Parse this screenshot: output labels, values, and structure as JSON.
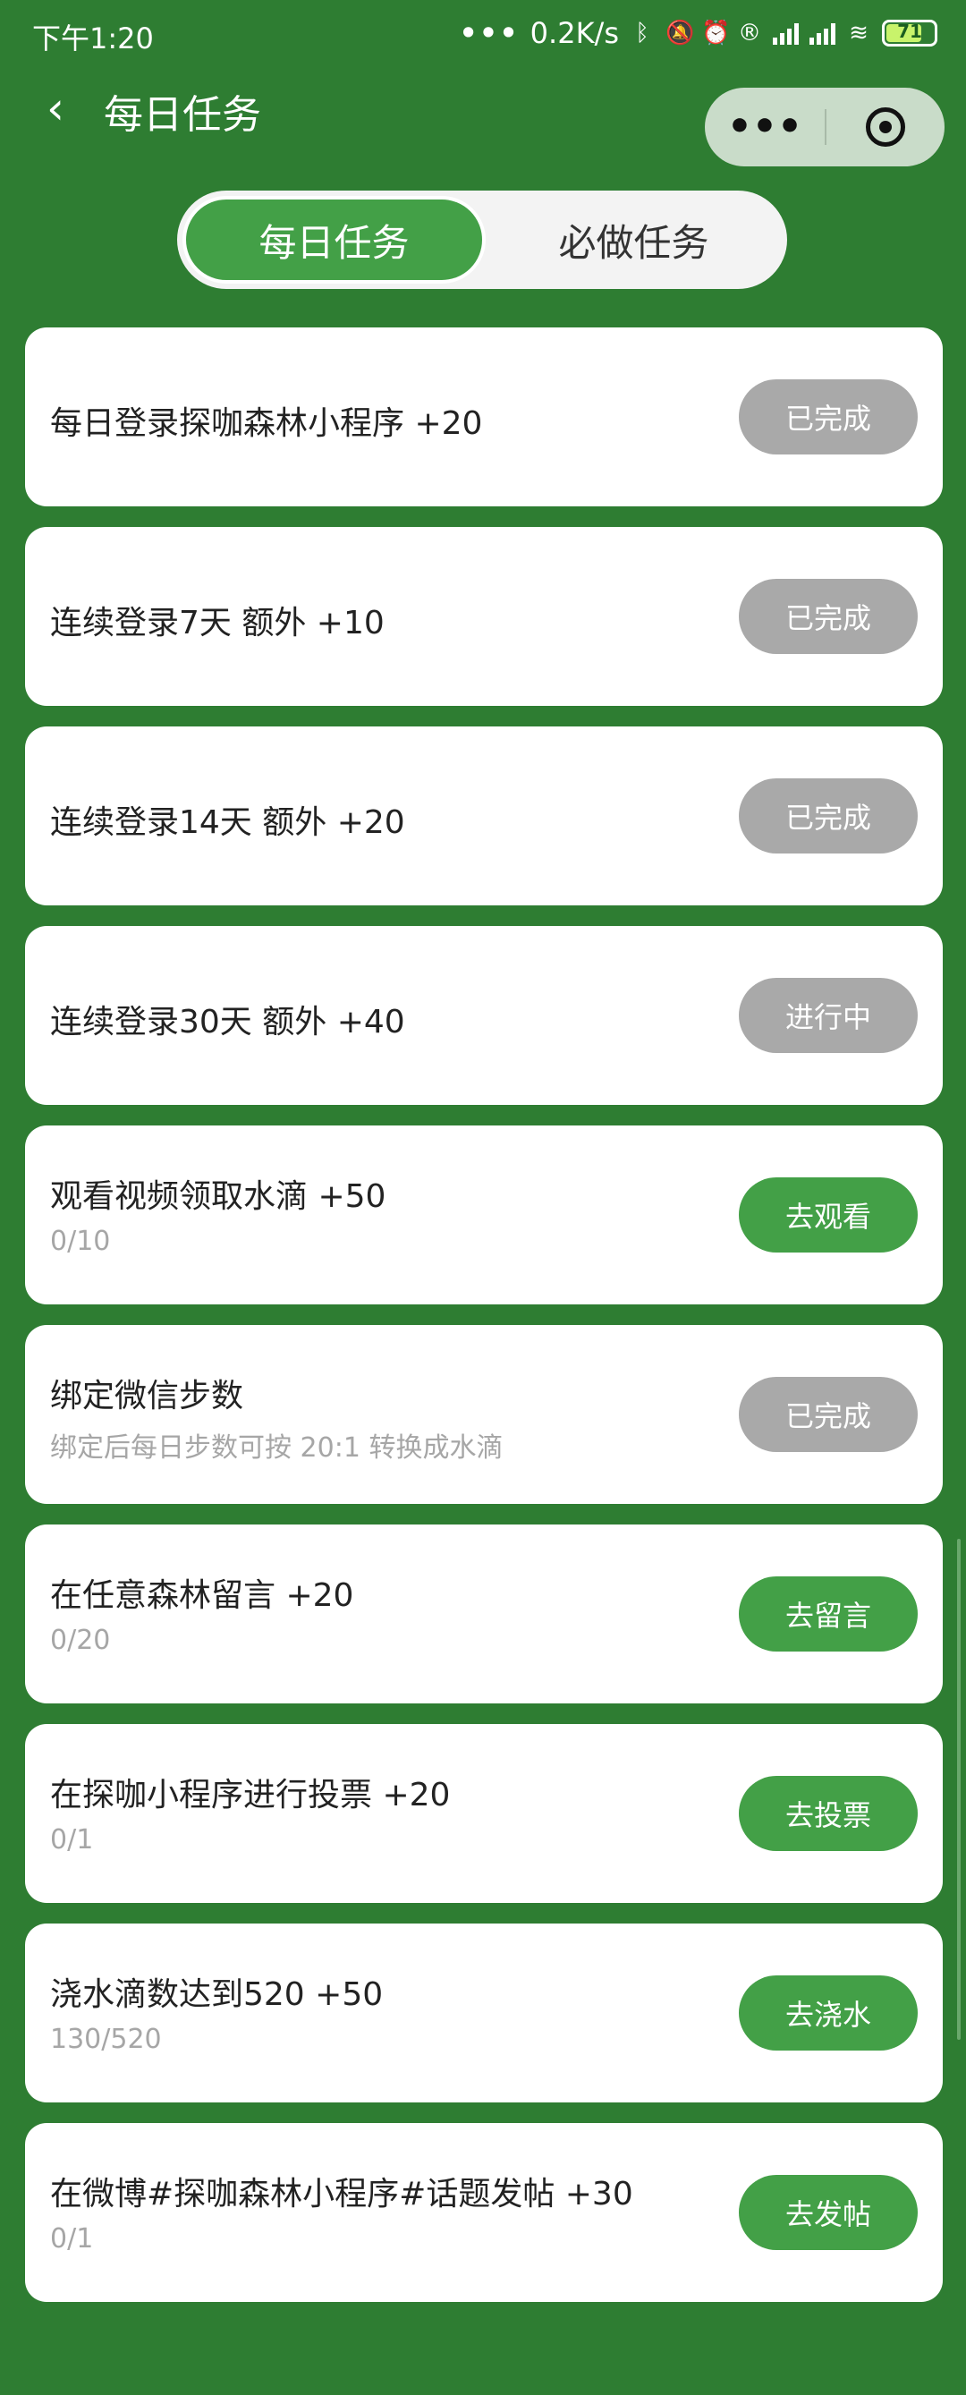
{
  "status_bar": {
    "time": "下午1:20",
    "dots": "•••",
    "net_speed": "0.2K/s",
    "battery": "71"
  },
  "nav": {
    "back_icon": "chevron-left-icon",
    "title": "每日任务",
    "more": "•••"
  },
  "tabs": [
    {
      "label": "每日任务",
      "active": true
    },
    {
      "label": "必做任务",
      "active": false
    }
  ],
  "tasks": [
    {
      "title": "每日登录探咖森林小程序 +20",
      "sub": "",
      "button": "已完成",
      "state": "done"
    },
    {
      "title": "连续登录7天 额外 +10",
      "sub": "",
      "button": "已完成",
      "state": "done"
    },
    {
      "title": "连续登录14天 额外 +20",
      "sub": "",
      "button": "已完成",
      "state": "done"
    },
    {
      "title": "连续登录30天 额外 +40",
      "sub": "",
      "button": "进行中",
      "state": "done"
    },
    {
      "title": "观看视频领取水滴 +50",
      "sub": "0/10",
      "button": "去观看",
      "state": "go"
    },
    {
      "title": "绑定微信步数",
      "sub": "绑定后每日步数可按 20:1 转换成水滴",
      "button": "已完成",
      "state": "done"
    },
    {
      "title": "在任意森林留言 +20",
      "sub": "0/20",
      "button": "去留言",
      "state": "go"
    },
    {
      "title": "在探咖小程序进行投票 +20",
      "sub": "0/1",
      "button": "去投票",
      "state": "go"
    },
    {
      "title": "浇水滴数达到520 +50",
      "sub": "130/520",
      "button": "去浇水",
      "state": "go"
    },
    {
      "title": "在微博#探咖森林小程序#话题发帖 +30",
      "sub": "0/1",
      "button": "去发帖",
      "state": "go"
    }
  ],
  "colors": {
    "background": "#2e7d32",
    "accent": "#43a047",
    "done_button": "#a9a9a9"
  }
}
